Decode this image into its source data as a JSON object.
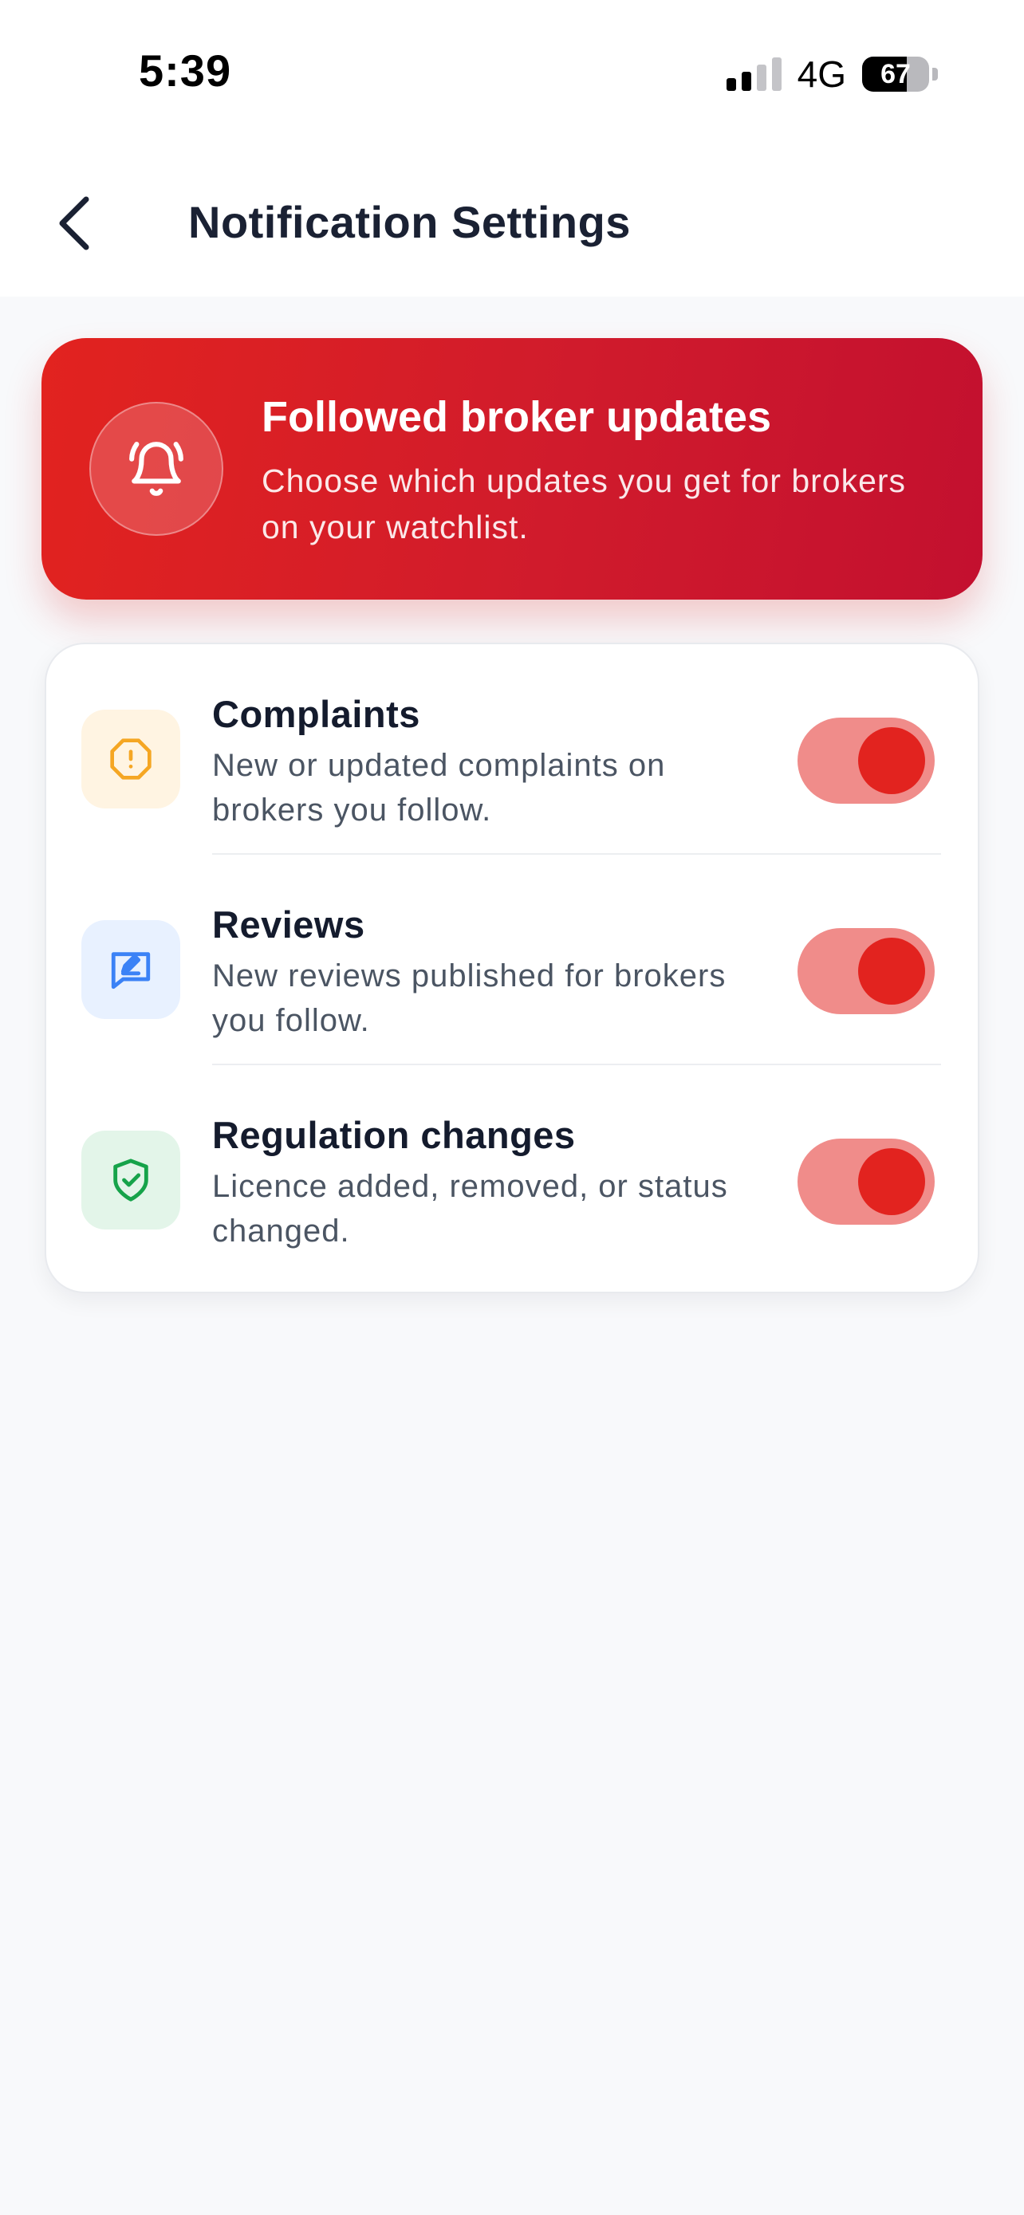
{
  "status_bar": {
    "time": "5:39",
    "network": "4G",
    "battery": "67",
    "battery_level": 0.67,
    "signal_bars_active": 2,
    "signal_bars_total": 4
  },
  "nav": {
    "title": "Notification Settings",
    "back_icon": "chevron-left-icon"
  },
  "hero": {
    "icon": "bell-ringing-icon",
    "title": "Followed broker updates",
    "subtitle": "Choose which updates you get for brokers on your watchlist."
  },
  "settings": [
    {
      "title": "Complaints",
      "description": "New or updated complaints on brokers you follow.",
      "icon": "alert-octagon-icon",
      "icon_color": "#f5a623",
      "icon_bg": "#fff4e2",
      "enabled": true
    },
    {
      "title": "Reviews",
      "description": "New reviews published for brokers you follow.",
      "icon": "message-edit-icon",
      "icon_color": "#3b82f6",
      "icon_bg": "#e8f1ff",
      "enabled": true
    },
    {
      "title": "Regulation changes",
      "description": "Licence added, removed, or status changed.",
      "icon": "shield-check-icon",
      "icon_color": "#16a34a",
      "icon_bg": "#e3f5e9",
      "enabled": true
    }
  ],
  "colors": {
    "accent": "#e2231f",
    "toggle_track": "#f08c8a",
    "background": "#f8f9fb"
  }
}
